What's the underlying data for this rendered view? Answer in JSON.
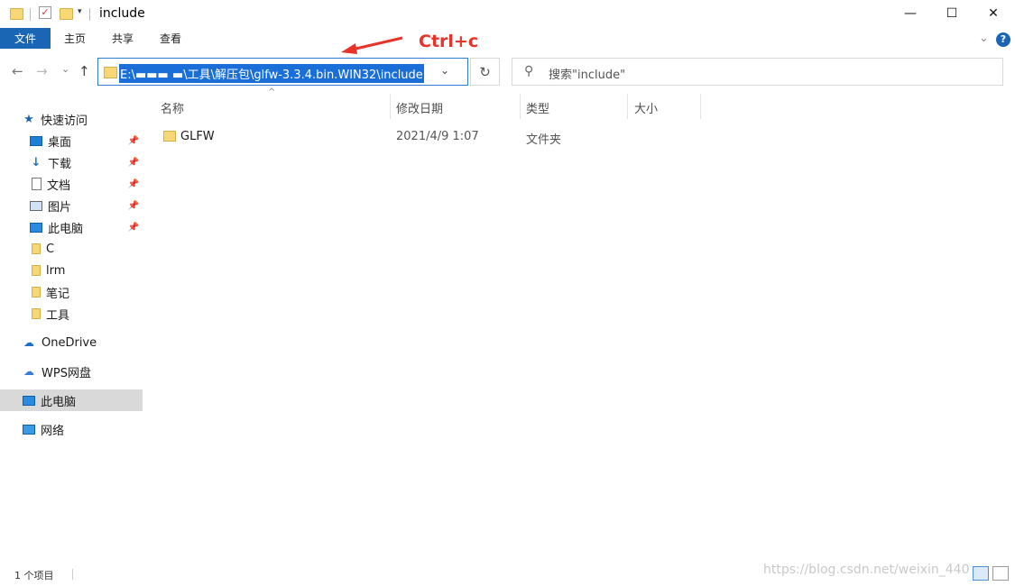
{
  "window": {
    "title": "include",
    "minimize_glyph": "—",
    "maximize_glyph": "☐",
    "close_glyph": "✕"
  },
  "ribbon": {
    "file_tab": "文件",
    "tabs": [
      "主页",
      "共享",
      "查看"
    ],
    "expand_glyph": "⌄",
    "help_glyph": "?"
  },
  "nav": {
    "back_glyph": "←",
    "forward_glyph": "→",
    "recent_glyph": "⌄",
    "up_glyph": "↑",
    "address_value": "E:\\▬▬▬ ▬\\工具\\解压包\\glfw-3.3.4.bin.WIN32\\include",
    "address_dropdown_glyph": "⌄",
    "refresh_glyph": "↻",
    "search_placeholder": "搜索\"include\""
  },
  "annotation": {
    "label": "Ctrl+c",
    "color": "#e8332a"
  },
  "sidebar": {
    "quick_access": "快速访问",
    "items": [
      {
        "label": "桌面",
        "icon": "desktop-icon",
        "pinned": true
      },
      {
        "label": "下载",
        "icon": "download-arrow-icon",
        "pinned": true
      },
      {
        "label": "文档",
        "icon": "document-icon",
        "pinned": true
      },
      {
        "label": "图片",
        "icon": "pictures-icon",
        "pinned": true
      },
      {
        "label": "此电脑",
        "icon": "computer-icon",
        "pinned": true
      },
      {
        "label": "C",
        "icon": "folder-icon",
        "pinned": false
      },
      {
        "label": "lrm",
        "icon": "folder-icon",
        "pinned": false
      },
      {
        "label": "笔记",
        "icon": "folder-icon",
        "pinned": false
      },
      {
        "label": "工具",
        "icon": "folder-icon",
        "pinned": false
      }
    ],
    "onedrive": "OneDrive",
    "wps": "WPS网盘",
    "this_pc": "此电脑",
    "network": "网络"
  },
  "content": {
    "sort_glyph": "^",
    "columns": [
      "名称",
      "修改日期",
      "类型",
      "大小"
    ],
    "rows": [
      {
        "name": "GLFW",
        "modified": "2021/4/9 1:07",
        "type": "文件夹",
        "size": ""
      }
    ]
  },
  "status": {
    "item_count": "1 个项目"
  },
  "watermark": "https://blog.csdn.net/weixin_440",
  "colors": {
    "accent": "#1a66b5",
    "selection": "#1a6ed8",
    "folder": "#f8d775"
  }
}
